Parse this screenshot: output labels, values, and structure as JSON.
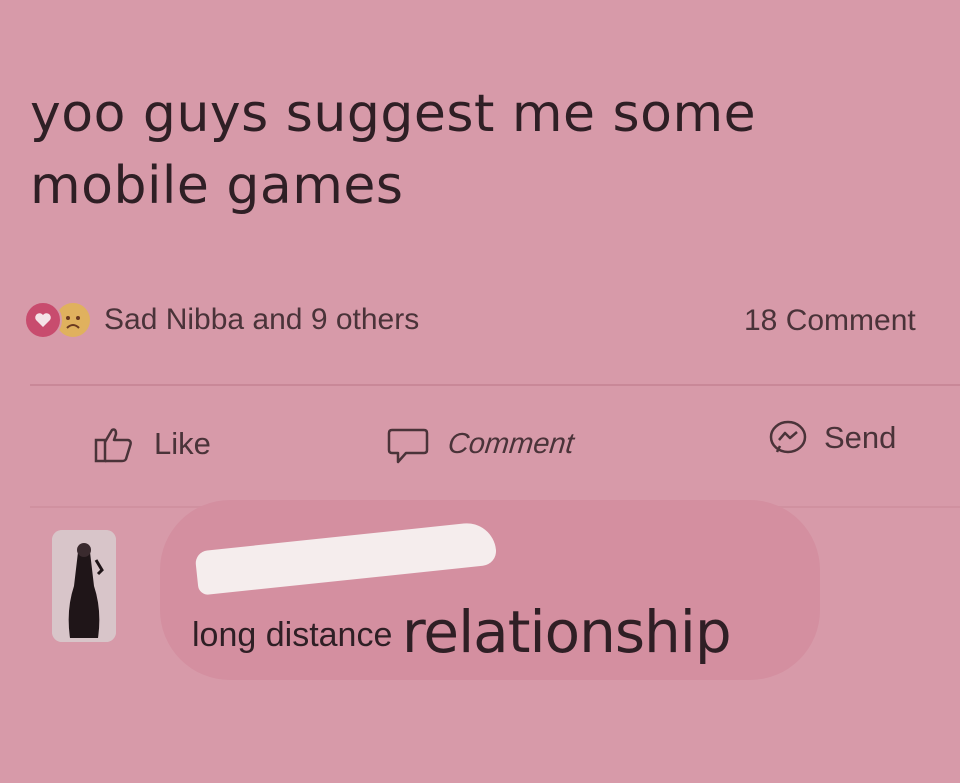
{
  "post": {
    "text": "yoo guys suggest me some mobile games"
  },
  "reactions": {
    "summary": "Sad Nibba and 9 others",
    "icons": [
      "heart-icon",
      "sad-face-icon"
    ],
    "comments_count": "18 Comment"
  },
  "actions": {
    "like_label": "Like",
    "comment_label": "Comment",
    "send_label": "Send"
  },
  "comment": {
    "author": "",
    "text_part1": "long distance ",
    "text_part2": "relationship"
  },
  "colors": {
    "background": "#d79aa9",
    "bubble": "#d48fa0",
    "text": "#2f1f25",
    "heart": "#c84c6e",
    "sad": "#e0b15e"
  }
}
